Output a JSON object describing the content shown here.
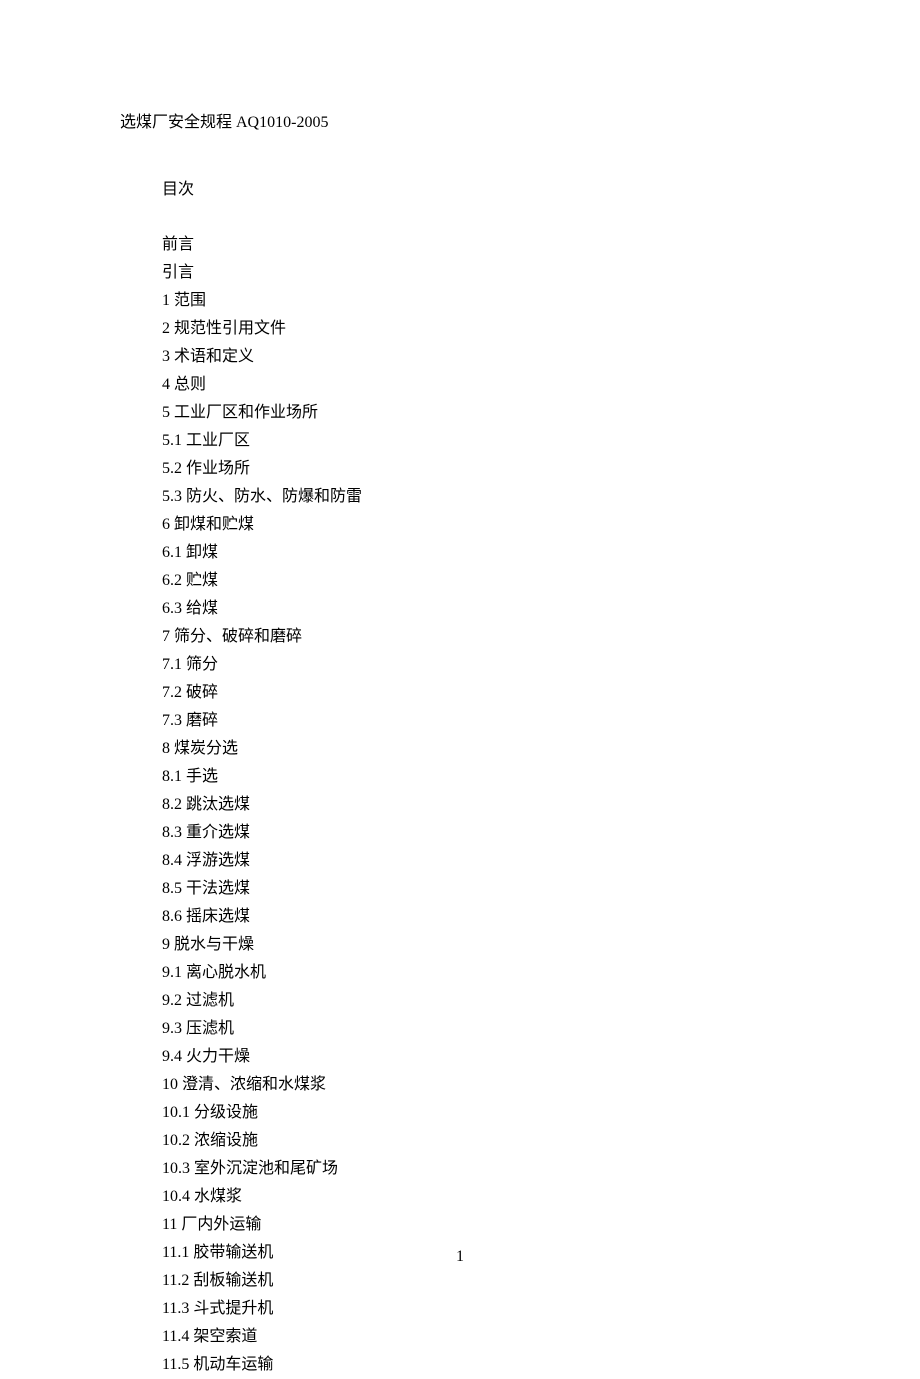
{
  "doc_title": "选煤厂安全规程 AQ1010-2005",
  "toc_label": "目次",
  "toc_items": [
    "前言",
    "引言",
    "1 范围",
    "2 规范性引用文件",
    "3 术语和定义",
    "4 总则",
    "5 工业厂区和作业场所",
    "5.1 工业厂区",
    "5.2 作业场所",
    "5.3 防火、防水、防爆和防雷",
    "6 卸煤和贮煤",
    "6.1 卸煤",
    "6.2 贮煤",
    "6.3 给煤",
    "7 筛分、破碎和磨碎",
    "7.1 筛分",
    "7.2 破碎",
    "7.3 磨碎",
    "8 煤炭分选",
    "8.1 手选",
    "8.2 跳汰选煤",
    "8.3 重介选煤",
    "8.4 浮游选煤",
    "8.5 干法选煤",
    "8.6 摇床选煤",
    "9 脱水与干燥",
    "9.1 离心脱水机",
    "9.2 过滤机",
    "9.3 压滤机",
    "9.4 火力干燥",
    "10 澄清、浓缩和水煤浆",
    "10.1 分级设施",
    "10.2 浓缩设施",
    "10.3 室外沉淀池和尾矿场",
    "10.4 水煤浆",
    "11 厂内外运输",
    "11.1 胶带输送机",
    "11.2 刮板输送机",
    "11.3 斗式提升机",
    "11.4 架空索道",
    "11.5 机动车运输"
  ],
  "page_number": "1"
}
